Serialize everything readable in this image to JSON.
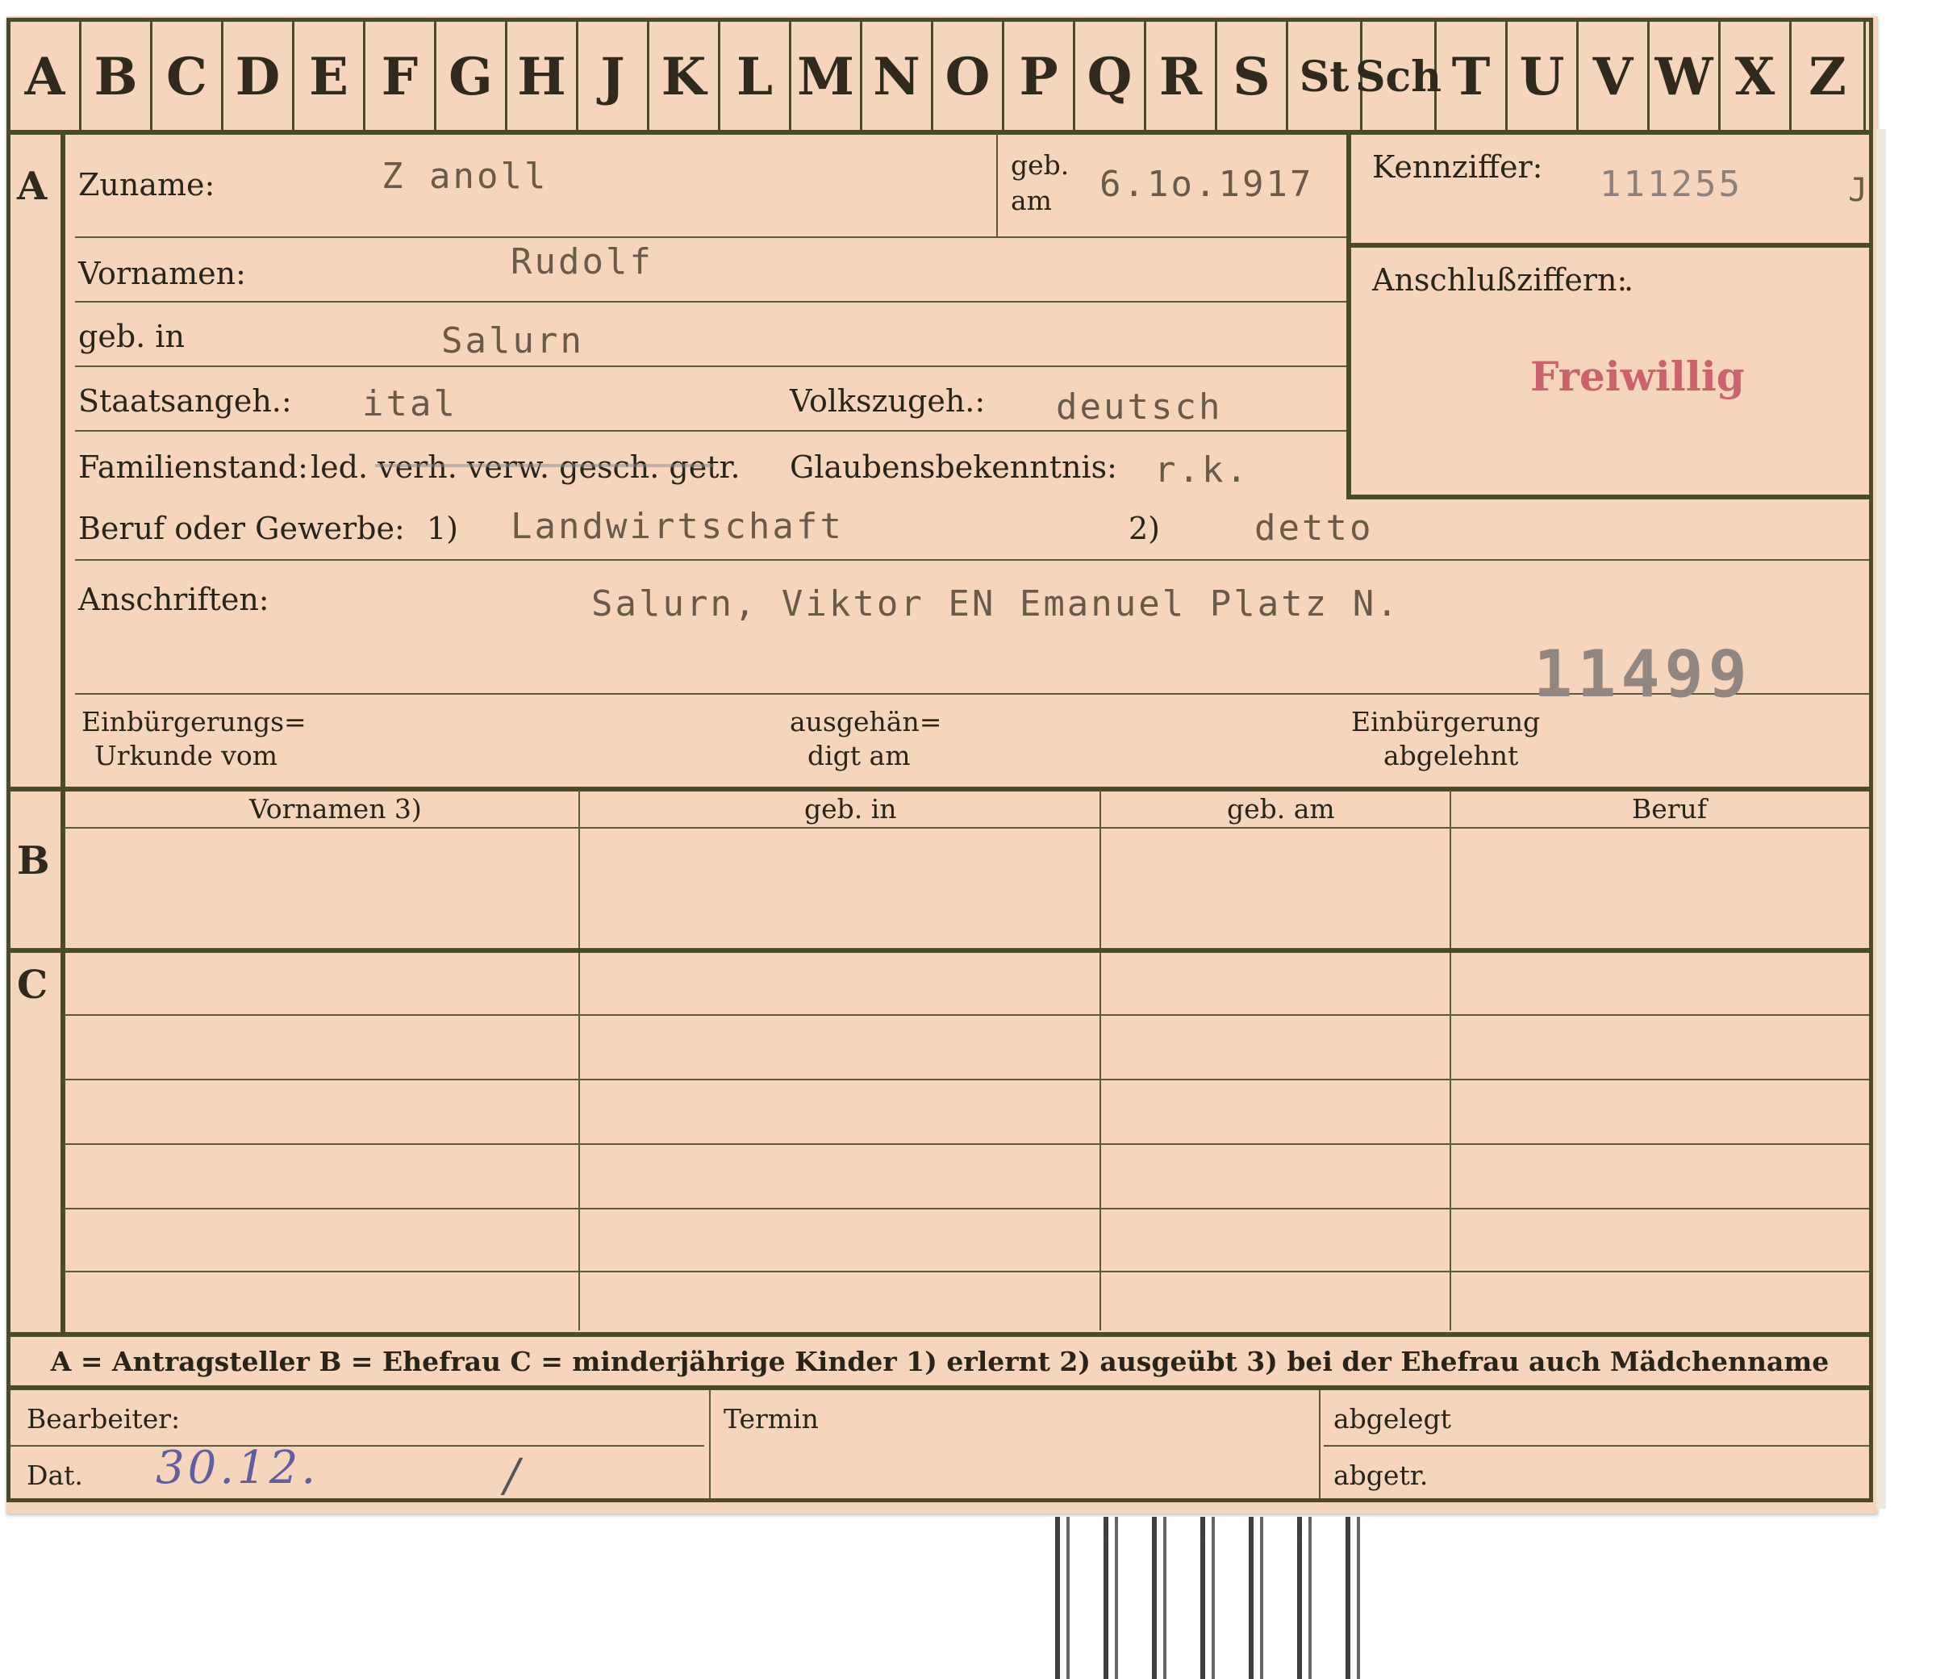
{
  "alphabet": [
    "A",
    "B",
    "C",
    "D",
    "E",
    "F",
    "G",
    "H",
    "J",
    "K",
    "L",
    "M",
    "N",
    "O",
    "P",
    "Q",
    "R",
    "S",
    "St",
    "Sch",
    "T",
    "U",
    "V",
    "W",
    "X",
    "Z"
  ],
  "sections": {
    "a": "A",
    "b": "B",
    "c": "C"
  },
  "labels": {
    "zuname": "Zuname:",
    "geb_am_line1": "geb.",
    "geb_am_line2": "am",
    "kennziffer": "Kennziffer:",
    "vornamen": "Vornamen:",
    "anschlussziffern": "Anschlußziffern:",
    "geb_in": "geb. in",
    "staatsangeh": "Staatsangeh.:",
    "volkszugeh": "Volkszugeh.:",
    "familienstand": "Familienstand:",
    "familienstand_options": "led. verh. verw. gesch. getr.",
    "glaubensbekenntnis": "Glaubensbekenntnis:",
    "beruf": "Beruf oder Gewerbe:",
    "beruf_note1": "1)",
    "beruf_note2": "2)",
    "anschriften": "Anschriften:",
    "einbuergerung_urkunde_1": "Einbürgerungs=",
    "einbuergerung_urkunde_2": "Urkunde vom",
    "ausgehaendigt_1": "ausgehän=",
    "ausgehaendigt_2": "digt am",
    "einbuergerung_abgelehnt_1": "Einbürgerung",
    "einbuergerung_abgelehnt_2": "abgelehnt",
    "col_vornamen": "Vornamen 3)",
    "col_geb_in": "geb. in",
    "col_geb_am": "geb. am",
    "col_beruf": "Beruf",
    "legend": "A = Antragsteller   B = Ehefrau   C = minderjährige Kinder   1) erlernt   2) ausgeübt   3) bei der Ehefrau auch Mädchenname",
    "bearbeiter": "Bearbeiter:",
    "dat": "Dat.",
    "termin": "Termin",
    "abgelegt": "abgelegt",
    "abgetr": "abgetr."
  },
  "values": {
    "zuname": "Z anoll",
    "geb_am": "6.1o.1917",
    "kennziffer": "111255",
    "kennziffer_suffix": "J",
    "anschlussziffern": ".",
    "vornamen": "Rudolf",
    "geb_in": "Salurn",
    "staatsangeh": "ital",
    "volkszugeh": "deutsch",
    "glaubensbekenntnis": "r.k.",
    "beruf_erlernt": "Landwirtschaft",
    "beruf_ausgeuebt": "detto",
    "anschrift": "Salurn, Viktor EN Emanuel Platz N.",
    "file_number": "11499",
    "stamp": "Freiwillig",
    "dat": "30.12.",
    "dat_suffix": "/"
  },
  "colors": {
    "card": "#f5d6bd",
    "ink": "#4b4a2c",
    "stamp": "#c24658"
  }
}
